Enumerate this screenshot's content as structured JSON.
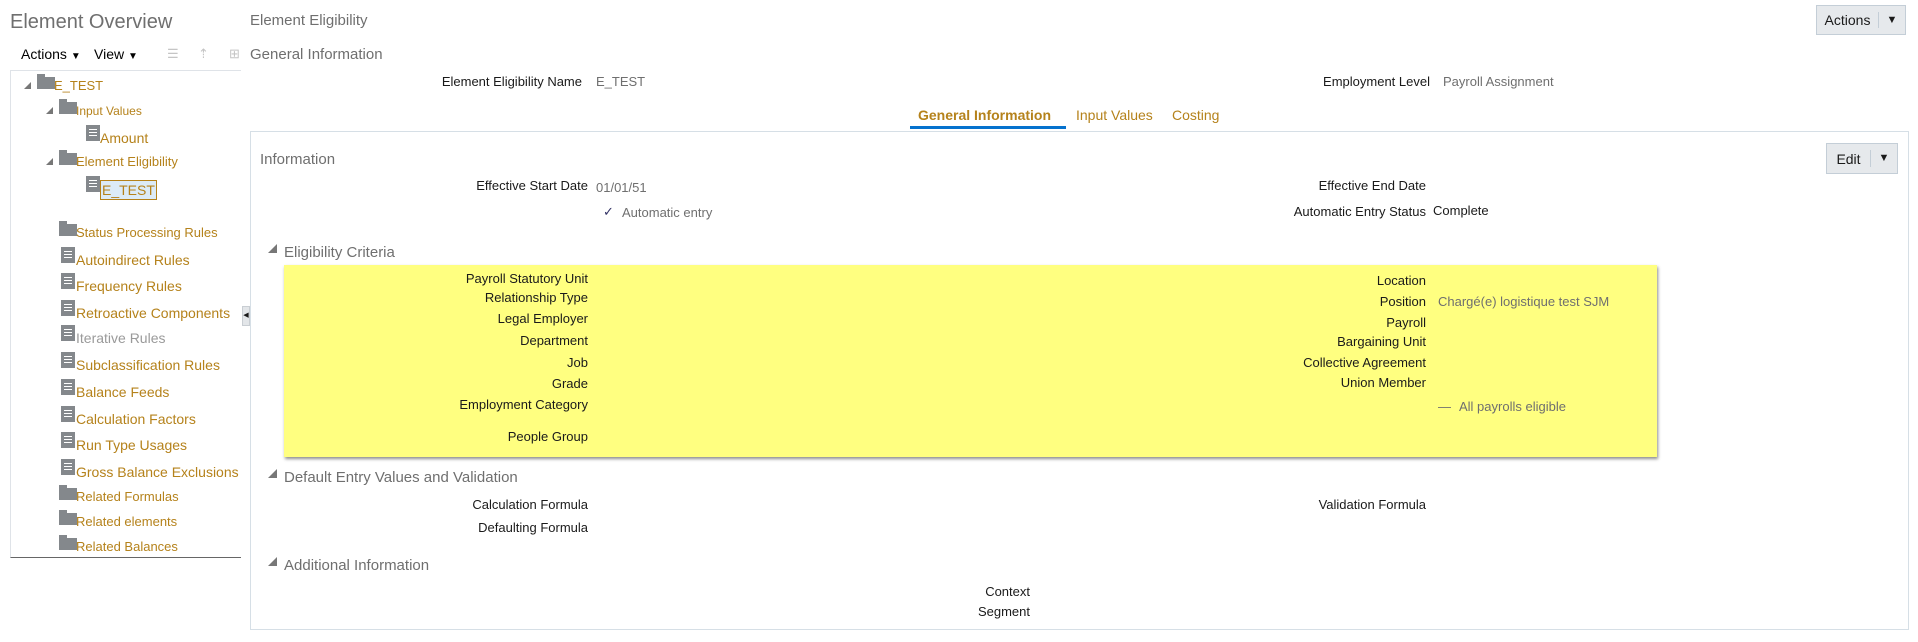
{
  "left": {
    "title": "Element Overview",
    "toolbar": {
      "actions": "Actions",
      "view": "View"
    },
    "tree": [
      {
        "label": "E_TEST",
        "icon": "folder"
      },
      {
        "label": "Input Values",
        "icon": "folder"
      },
      {
        "label": "Amount",
        "icon": "document"
      },
      {
        "label": "Element Eligibility",
        "icon": "folder"
      },
      {
        "label": "E_TEST",
        "icon": "document",
        "selected": true
      },
      {
        "label": "Status Processing Rules",
        "icon": "folder"
      },
      {
        "label": "Autoindirect Rules",
        "icon": "document"
      },
      {
        "label": "Frequency Rules",
        "icon": "document"
      },
      {
        "label": "Retroactive Components",
        "icon": "document"
      },
      {
        "label": "Iterative Rules",
        "icon": "document",
        "disabled": true
      },
      {
        "label": "Subclassification Rules",
        "icon": "document"
      },
      {
        "label": "Balance Feeds",
        "icon": "document"
      },
      {
        "label": "Calculation Factors",
        "icon": "document"
      },
      {
        "label": "Run Type Usages",
        "icon": "document"
      },
      {
        "label": "Gross Balance Exclusions",
        "icon": "document"
      },
      {
        "label": "Related Formulas",
        "icon": "folder"
      },
      {
        "label": "Related elements",
        "icon": "folder"
      },
      {
        "label": "Related Balances",
        "icon": "folder"
      }
    ]
  },
  "main": {
    "title": "Element Eligibility",
    "actions_label": "Actions",
    "section": "General Information",
    "name_label": "Element Eligibility Name",
    "name_value": "E_TEST",
    "level_label": "Employment Level",
    "level_value": "Payroll Assignment",
    "tabs": [
      {
        "label": "General Information",
        "active": true
      },
      {
        "label": "Input Values"
      },
      {
        "label": "Costing"
      }
    ],
    "info": {
      "title": "Information",
      "edit_label": "Edit",
      "start_label": "Effective Start Date",
      "start_value": "01/01/51",
      "end_label": "Effective End Date",
      "auto_entry": "Automatic entry",
      "auto_status_label": "Automatic Entry Status",
      "auto_status_value": "Complete"
    },
    "eligibility": {
      "title": "Eligibility Criteria",
      "left": [
        "Payroll Statutory Unit",
        "Relationship Type",
        "Legal Employer",
        "Department",
        "Job",
        "Grade",
        "Employment Category",
        "People Group"
      ],
      "right": [
        "Location",
        "Position",
        "Payroll",
        "Bargaining Unit",
        "Collective Agreement",
        "Union Member"
      ],
      "position_value": "Chargé(e) logistique test SJM",
      "all_payrolls": "All payrolls eligible"
    },
    "defaults": {
      "title": "Default Entry Values and Validation",
      "calc": "Calculation Formula",
      "defaulting": "Defaulting Formula",
      "validation": "Validation Formula"
    },
    "additional": {
      "title": "Additional Information",
      "context": "Context",
      "segment": "Segment"
    }
  },
  "colors": {
    "link": "#b5821b",
    "highlight": "#ffff80",
    "tab_underline": "#0572ce"
  }
}
